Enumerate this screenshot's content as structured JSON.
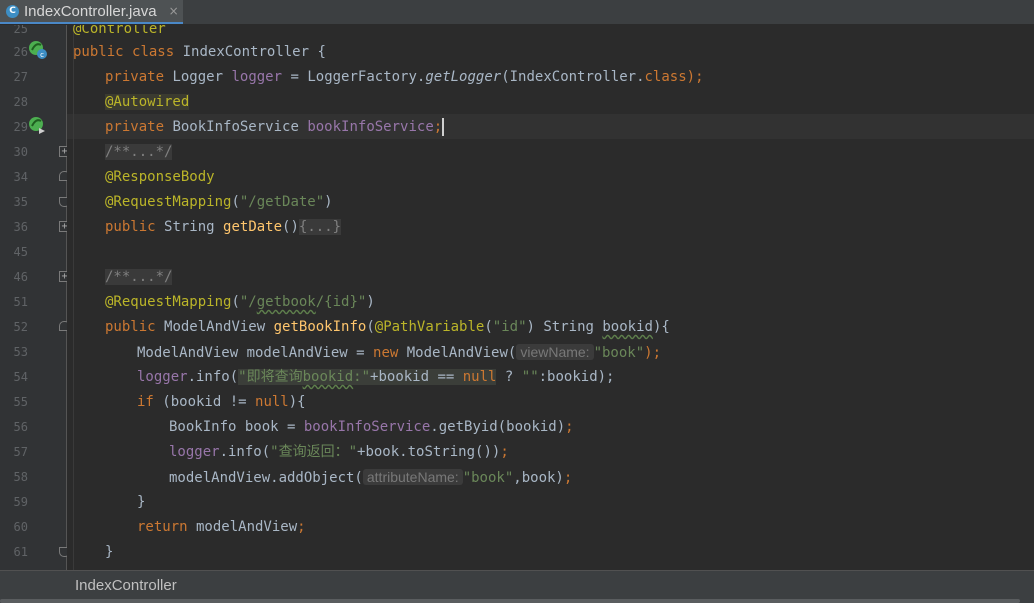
{
  "tab": {
    "title": "IndexController.java",
    "badge": "C",
    "close": "×"
  },
  "breadcrumb": "IndexController",
  "gutter": {
    "line_numbers": [
      "25",
      "26",
      "27",
      "28",
      "29",
      "30",
      "34",
      "35",
      "36",
      "45",
      "46",
      "51",
      "52",
      "53",
      "54",
      "55",
      "56",
      "57",
      "58",
      "59",
      "60",
      "61"
    ]
  },
  "code": {
    "l25": "@Controller",
    "l26": {
      "k1": "public",
      "k2": "class",
      "name": "IndexController {"
    },
    "l27": {
      "k1": "private",
      "t": "Logger",
      "f": "logger",
      "eq": " = LoggerFactory.",
      "m": "getLogger",
      "rest": "(IndexController.",
      "k2": "class",
      "end": ");"
    },
    "l28": "@Autowired",
    "l29": {
      "k1": "private",
      "t": "BookInfoService",
      "f": "bookInfoService",
      "end": ";"
    },
    "l30": "/**...*/",
    "l34": "@ResponseBody",
    "l35": {
      "a": "@RequestMapping",
      "p1": "(",
      "s": "\"/getDate\"",
      "p2": ")"
    },
    "l36": {
      "k1": "public",
      "t": "String",
      "m": "getDate",
      "p": "()",
      "fold": "{...}"
    },
    "l46": "/**...*/",
    "l51": {
      "a": "@RequestMapping",
      "p1": "(",
      "s1": "\"/",
      "s2": "getbook",
      "s3": "/{id}\"",
      "p2": ")"
    },
    "l52": {
      "k1": "public",
      "t": "ModelAndView",
      "m": "getBookInfo",
      "p1": "(",
      "a": "@PathVariable",
      "p2": "(",
      "s": "\"id\"",
      "p3": ") String ",
      "v": "bookid",
      "end": "){"
    },
    "l53": {
      "t": "ModelAndView modelAndView = ",
      "k": "new",
      "c": " ModelAndView(",
      "hint": "viewName:",
      "s": "\"book\"",
      "end": ");"
    },
    "l54": {
      "f": "logger",
      "m": ".info(",
      "s1": "\"即将查询",
      "s2": "bookid",
      "s3": ":\"",
      "plus": "+bookid == ",
      "k": "null",
      "q": " ? ",
      "s4": "\"\"",
      "end": ":bookid);"
    },
    "l55": {
      "k": "if",
      "p": " (bookid != ",
      "k2": "null",
      "end": "){"
    },
    "l56": {
      "t": "BookInfo book = ",
      "f": "bookInfoService",
      "m": ".getByid(bookid)",
      "end": ";"
    },
    "l57": {
      "f": "logger",
      "m": ".info(",
      "s": "\"查询返回：\"",
      "plus": "+book.toString())",
      "end": ";"
    },
    "l58": {
      "t": "modelAndView.addObject(",
      "hint": "attributeName:",
      "s": "\"book\"",
      "c": ",book)",
      "end": ";"
    },
    "l59": "}",
    "l60": {
      "k": "return",
      "v": " modelAndView",
      "end": ";"
    },
    "l61": "}"
  }
}
